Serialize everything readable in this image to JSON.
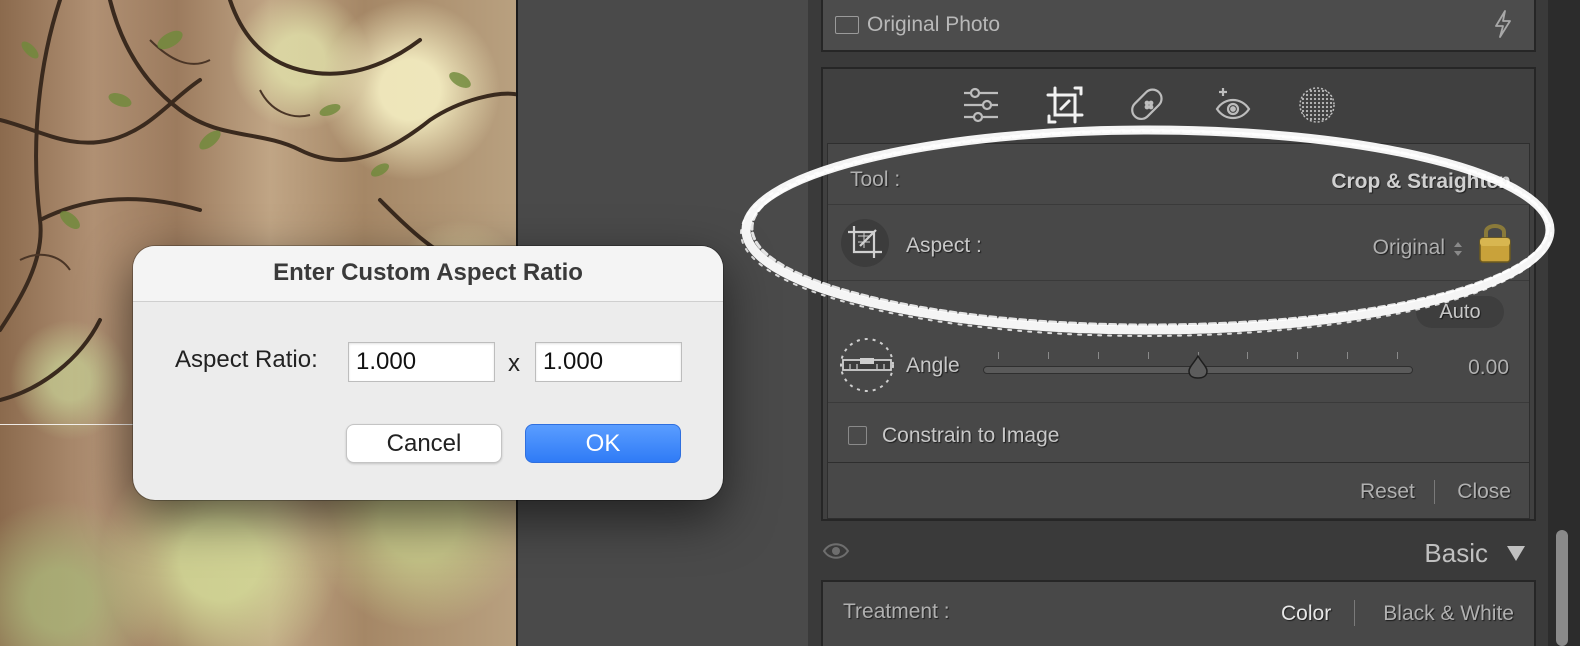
{
  "original_photo": {
    "label": "Original Photo",
    "icon": "bolt-icon"
  },
  "toolstrip": {
    "icons": [
      "edit-sliders-icon",
      "crop-icon",
      "healing-bandage-icon",
      "redeye-icon",
      "mask-icon"
    ]
  },
  "crop": {
    "tool_label": "Tool :",
    "tool_value": "Crop & Straighten",
    "aspect_label": "Aspect :",
    "aspect_value": "Original",
    "auto_label": "Auto",
    "angle_label": "Angle",
    "angle_value": "0.00",
    "angle_position": 0.5,
    "constrain_label": "Constrain to Image",
    "constrain_checked": false,
    "reset_label": "Reset",
    "close_label": "Close"
  },
  "basic": {
    "title": "Basic",
    "treatment_label": "Treatment :",
    "color_label": "Color",
    "bw_label": "Black & White"
  },
  "dialog": {
    "title": "Enter Custom Aspect Ratio",
    "aspect_ratio_label": "Aspect Ratio:",
    "width_value": "1.000",
    "separator": "x",
    "height_value": "1.000",
    "cancel_label": "Cancel",
    "ok_label": "OK"
  },
  "colors": {
    "accent_blue": "#2f7bf6",
    "panel": "#404040",
    "lock_gold": "#c9a23a"
  }
}
